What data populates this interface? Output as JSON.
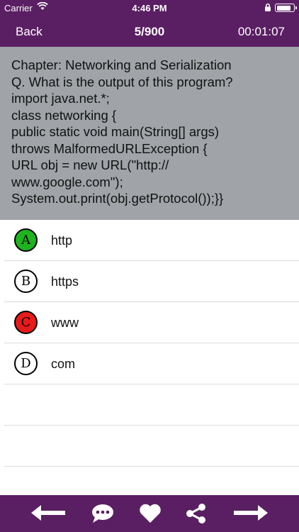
{
  "status": {
    "carrier": "Carrier",
    "time": "4:46 PM"
  },
  "navbar": {
    "back": "Back",
    "counter": "5/900",
    "timer": "00:01:07"
  },
  "question": {
    "lines": [
      "Chapter: Networking and Serialization",
      "Q. What is the output of this program?",
      "import java.net.*;",
      "class networking {",
      "public static void main(String[] args)",
      "throws MalformedURLException {",
      "URL obj = new URL(\"http://",
      "www.google.com\");",
      "System.out.print(obj.getProtocol());}}"
    ]
  },
  "options": [
    {
      "letter": "A",
      "text": "http",
      "state": "correct",
      "color": "#1eb41e"
    },
    {
      "letter": "B",
      "text": "https",
      "state": "neutral",
      "color": "#ffffff"
    },
    {
      "letter": "C",
      "text": "www",
      "state": "wrong",
      "color": "#e81a1a"
    },
    {
      "letter": "D",
      "text": "com",
      "state": "neutral",
      "color": "#ffffff"
    }
  ],
  "toolbar": {
    "icons": [
      "arrow-left-icon",
      "comment-icon",
      "heart-icon",
      "share-icon",
      "arrow-right-icon"
    ]
  },
  "colors": {
    "bar": "#5a1e63",
    "question_bg": "#a0a4a8"
  }
}
